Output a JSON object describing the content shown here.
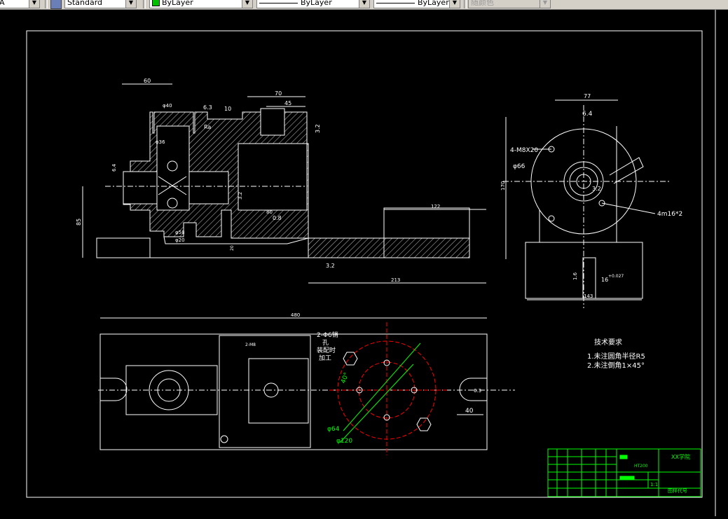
{
  "toolbar": {
    "first_combo_text": "A",
    "style_combo": "Standard",
    "layer_combo": "ByLayer",
    "linetype_combo": "ByLayer",
    "lineweight_combo": "ByLayer",
    "plotstyle_combo": "随颜色"
  },
  "drawing": {
    "dims_front": {
      "d60": "60",
      "d70": "70",
      "d45": "45",
      "d10": "10",
      "d63": "6.3",
      "ra": "Ra",
      "d40": "φ40",
      "d36": "φ36",
      "d64": "6.4",
      "d85": "85",
      "d58": "φ58",
      "d20": "φ20",
      "d32a": "3.2",
      "d32b": "3.2",
      "d32c": "3.2",
      "d80": "80",
      "d08": "0.8",
      "d122": "122",
      "d213": "213",
      "d20b": "20"
    },
    "dims_side": {
      "d77": "77",
      "d64": "6.4",
      "m8": "4-M8X20",
      "d66": "φ66",
      "d170": "170",
      "d32": "3.2",
      "m16": "4m16*2",
      "d16": "16",
      "d16tol": "+0.027",
      "d143": "143",
      "d16b": "1.6"
    },
    "dims_top": {
      "d480": "480",
      "d40": "40",
      "d64": "φ64",
      "d120": "φ120",
      "a40": "40°",
      "pin": "2-Φ6销",
      "pin2": "孔",
      "pin3": "装配时",
      "pin4": "加工",
      "m8": "2-M8",
      "d63": "6.3"
    },
    "notes": {
      "title": "技术要求",
      "line1": "1.未注圆角半径R5",
      "line2": "2.未注倒角1×45°"
    },
    "title_block": {
      "school": "XX学院",
      "material": "HT200",
      "scale": "1:1",
      "drawing_no": "图样代号"
    }
  },
  "colors": {
    "line": "#ffffff",
    "red": "#ff0000",
    "green": "#00ff00",
    "background": "#000000"
  }
}
